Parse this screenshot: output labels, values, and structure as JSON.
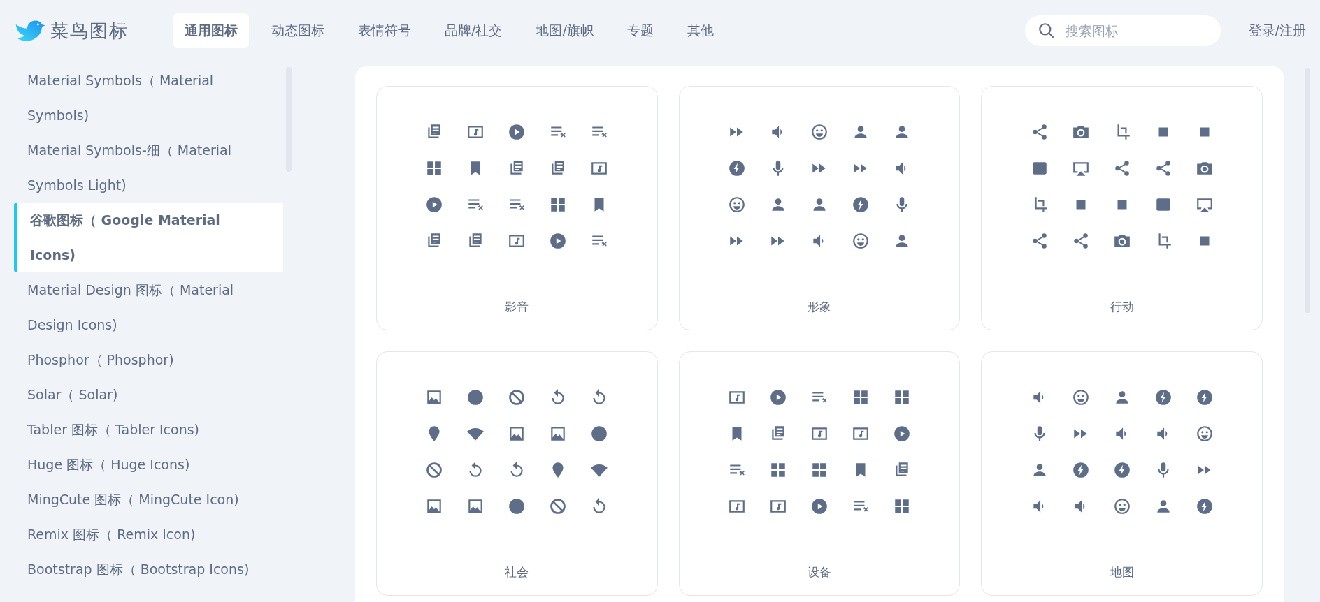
{
  "logo": {
    "text": "菜鸟图标"
  },
  "nav": [
    {
      "label": "通用图标",
      "selected": true
    },
    {
      "label": "动态图标",
      "selected": false
    },
    {
      "label": "表情符号",
      "selected": false
    },
    {
      "label": "品牌/社交",
      "selected": false
    },
    {
      "label": "地图/旗帜",
      "selected": false
    },
    {
      "label": "专题",
      "selected": false
    },
    {
      "label": "其他",
      "selected": false
    }
  ],
  "search": {
    "placeholder": "搜索图标"
  },
  "login": "登录/注册",
  "sidebar": {
    "items": [
      {
        "label": "Material Symbols（ Material Symbols)",
        "selected": false
      },
      {
        "label": "Material Symbols-细（ Material Symbols Light)",
        "selected": false
      },
      {
        "label": "谷歌图标（ Google Material Icons)",
        "selected": true
      },
      {
        "label": "Material Design 图标（ Material Design Icons)",
        "selected": false
      },
      {
        "label": "Phosphor（ Phosphor)",
        "selected": false
      },
      {
        "label": "Solar（ Solar)",
        "selected": false
      },
      {
        "label": "Tabler 图标（ Tabler Icons)",
        "selected": false
      },
      {
        "label": "Huge 图标（ Huge Icons)",
        "selected": false
      },
      {
        "label": "MingCute 图标（ MingCute Icon)",
        "selected": false
      },
      {
        "label": "Remix 图标（ Remix Icon)",
        "selected": false
      },
      {
        "label": "Bootstrap 图标（ Bootstrap Icons)",
        "selected": false
      }
    ]
  },
  "categories": [
    {
      "title": "影音"
    },
    {
      "title": "形象"
    },
    {
      "title": "行动"
    },
    {
      "title": "社会"
    },
    {
      "title": "设备"
    },
    {
      "title": "地图"
    }
  ]
}
